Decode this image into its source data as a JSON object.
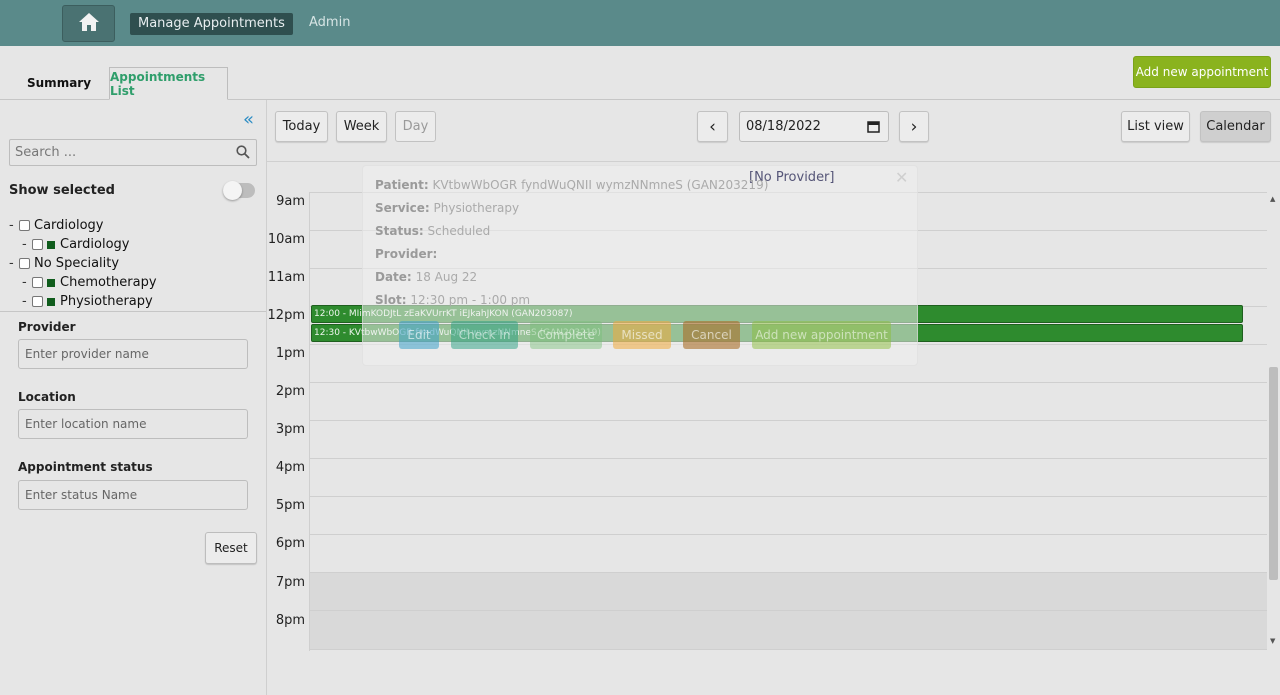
{
  "nav": {
    "home_icon": "home-icon",
    "active_item": "Manage Appointments",
    "admin": "Admin"
  },
  "tabs": {
    "summary": "Summary",
    "appointments_list": "Appointments List"
  },
  "header": {
    "add_new_appointment": "Add new appointment"
  },
  "sidebar": {
    "search_placeholder": "Search ...",
    "show_selected": "Show selected",
    "tree": [
      {
        "label": "Cardiology",
        "level": 0,
        "colored": false
      },
      {
        "label": "Cardiology",
        "level": 1,
        "colored": true
      },
      {
        "label": "No Speciality",
        "level": 0,
        "colored": false
      },
      {
        "label": "Chemotherapy",
        "level": 1,
        "colored": true
      },
      {
        "label": "Physiotherapy",
        "level": 1,
        "colored": true
      }
    ],
    "provider_label": "Provider",
    "provider_placeholder": "Enter provider name",
    "location_label": "Location",
    "location_placeholder": "Enter location name",
    "status_label": "Appointment status",
    "status_placeholder": "Enter status Name",
    "reset": "Reset"
  },
  "toolbar": {
    "today": "Today",
    "week": "Week",
    "day": "Day",
    "prev": "‹",
    "next": "›",
    "date": "08/18/2022",
    "list_view": "List view",
    "calendar": "Calendar"
  },
  "calendar": {
    "hours": [
      "9am",
      "10am",
      "11am",
      "12pm",
      "1pm",
      "2pm",
      "3pm",
      "4pm",
      "5pm",
      "6pm",
      "7pm",
      "8pm"
    ],
    "appointments": [
      {
        "text": "12:00 - MIimKODJtL zEaKVUrrKT iEJkahJKON (GAN203087)"
      },
      {
        "text": "12:30 - KVtbwWbOGR fyndWuQNII wymzNNmneS (GAN203219)"
      }
    ]
  },
  "popover": {
    "title": "[No Provider]",
    "patient_label": "Patient:",
    "patient_value": "KVtbwWbOGR fyndWuQNII wymzNNmneS (GAN203219)",
    "service_label": "Service:",
    "service_value": "Physiotherapy",
    "status_label": "Status:",
    "status_value": "Scheduled",
    "provider_label": "Provider:",
    "date_label": "Date:",
    "date_value": "18 Aug 22",
    "slot_label": "Slot:",
    "slot_value": "12:30 pm - 1:00 pm",
    "buttons": {
      "edit": "Edit",
      "check_in": "Check In",
      "complete": "Complete",
      "missed": "Missed",
      "cancel": "Cancel",
      "add_new": "Add new appointment"
    }
  },
  "colors": {
    "nav_bar": "#5a8a8a",
    "accent_green": "#8ab31e",
    "appointment_green": "#2e8b2e",
    "tab_active_text": "#2f9e6b"
  }
}
